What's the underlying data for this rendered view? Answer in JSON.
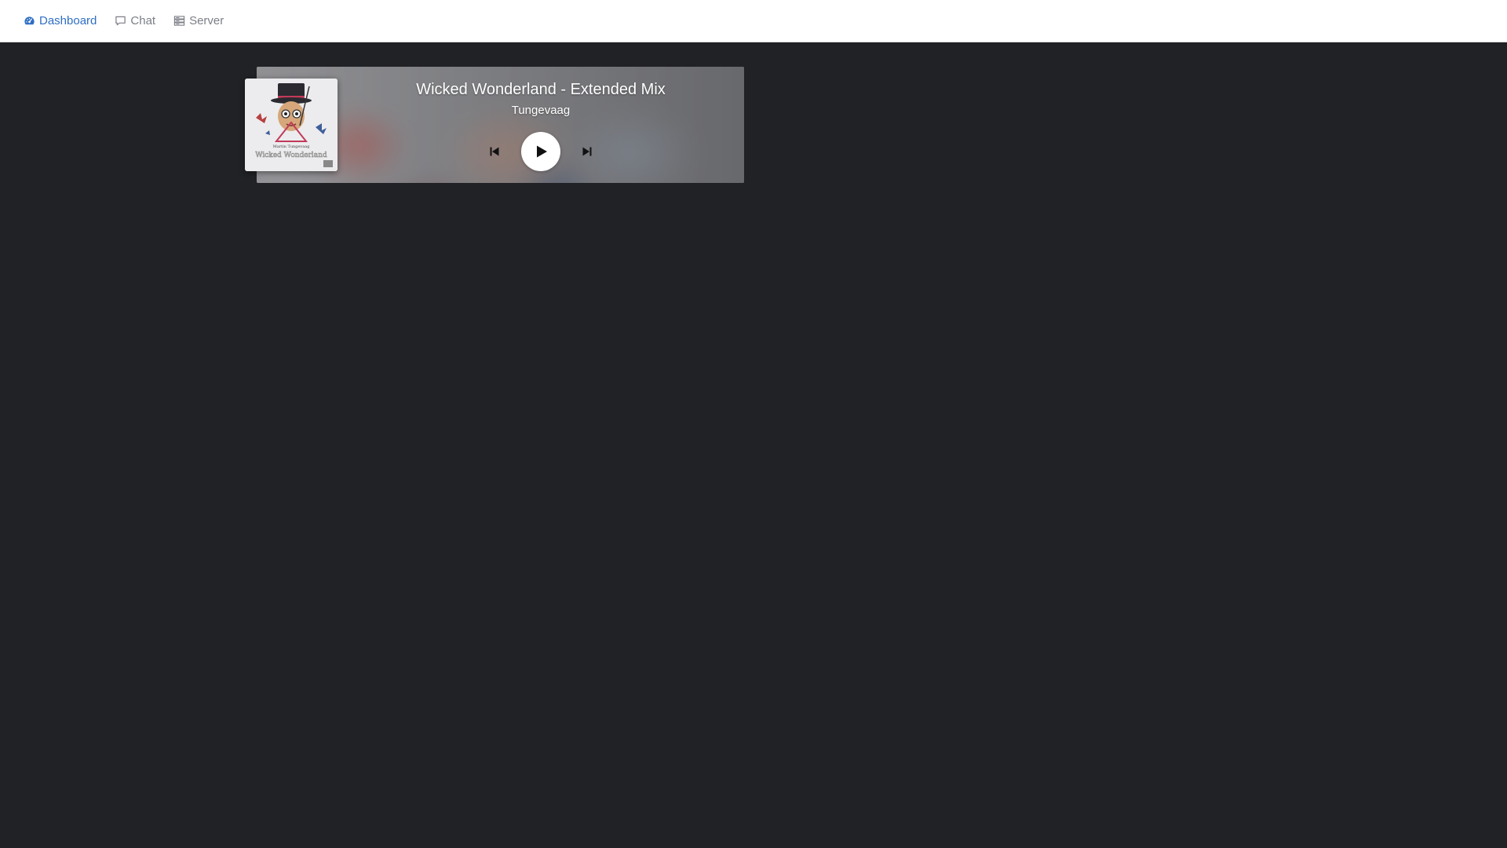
{
  "nav": {
    "items": [
      {
        "label": "Dashboard",
        "icon": "dashboard-icon",
        "active": true
      },
      {
        "label": "Chat",
        "icon": "chat-icon",
        "active": false
      },
      {
        "label": "Server",
        "icon": "server-icon",
        "active": false
      }
    ]
  },
  "player": {
    "title": "Wicked Wonderland - Extended Mix",
    "artist": "Tungevaag",
    "controls": {
      "previous_icon": "skip-previous-icon",
      "play_icon": "play-icon",
      "next_icon": "skip-next-icon"
    },
    "cover": {
      "top_text": "Martin Tungevaag",
      "bottom_text": "Wicked Wonderland"
    }
  },
  "colors": {
    "background": "#212226",
    "nav_active": "#2f6fc4",
    "nav_inactive": "#7b7f86"
  }
}
